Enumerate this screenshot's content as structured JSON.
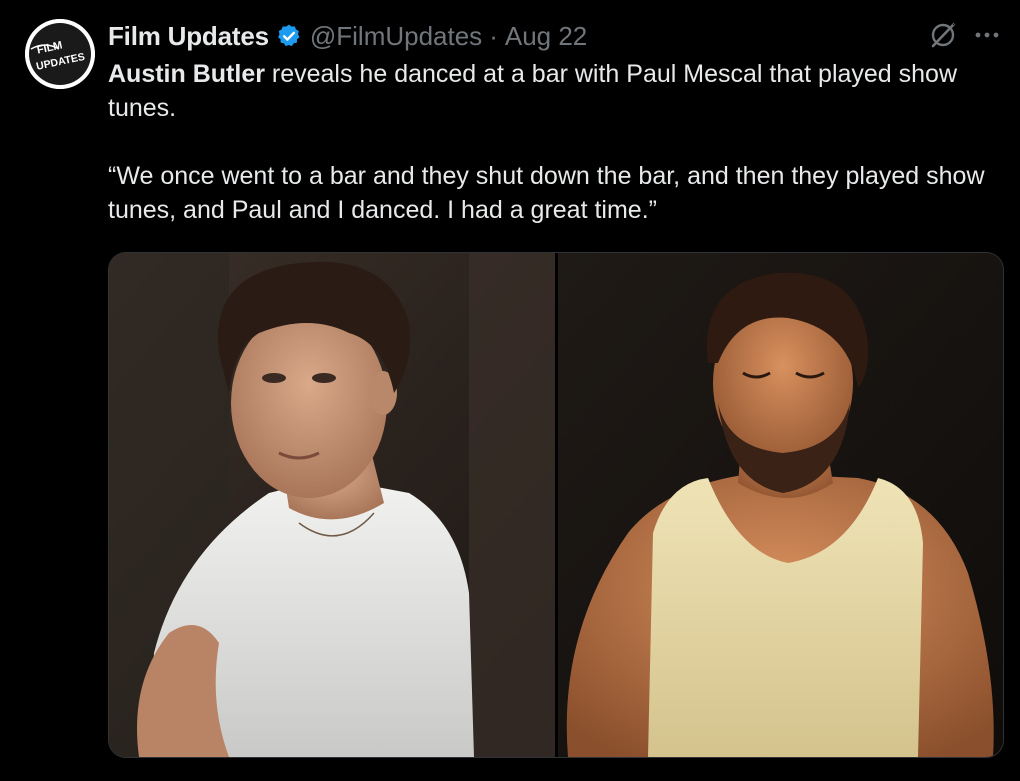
{
  "tweet": {
    "author_name": "Film Updates",
    "handle": "@FilmUpdates",
    "separator": "·",
    "date": "Aug 22",
    "avatar_text_line1": "FILM",
    "avatar_text_line2": "UPDATES",
    "mention": "Austin Butler",
    "text_rest": " reveals he danced at a bar with Paul Mescal that played show tunes.",
    "quote": "“We once went to a bar and they shut down the bar, and then they played show tunes, and Paul and I danced. I had a great time.”"
  },
  "icons": {
    "verified": "verified-badge-icon",
    "grok": "grok-icon",
    "more": "more-icon"
  },
  "colors": {
    "background": "#000000",
    "text": "#e7e9ea",
    "secondary": "#71767b",
    "verified": "#1d9bf0"
  },
  "media": {
    "left_photo": "portrait-man-white-tshirt",
    "right_photo": "portrait-man-tank-top"
  }
}
